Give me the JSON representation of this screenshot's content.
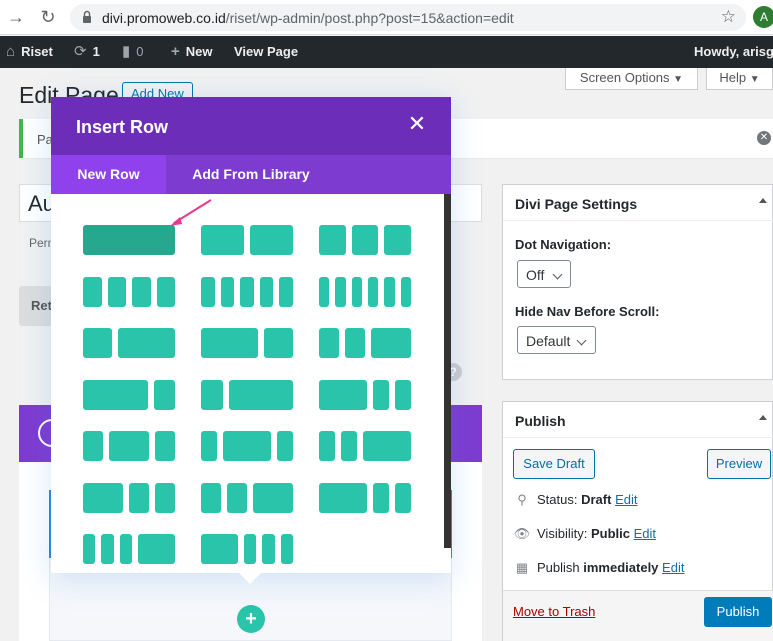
{
  "browser": {
    "url_host": "divi.promoweb.co.id",
    "url_path": "/riset/wp-admin/post.php?post=15&action=edit",
    "profile_initial": "A"
  },
  "admin_bar": {
    "site_name": "Riset",
    "updates_count": "1",
    "comments_count": "0",
    "new_label": "New",
    "view_page_label": "View Page",
    "greeting": "Howdy, arisg"
  },
  "header": {
    "title": "Edit Page",
    "add_new": "Add New",
    "screen_options": "Screen Options",
    "help": "Help"
  },
  "notice": {
    "text": "Pa"
  },
  "editor": {
    "title_value": "Au",
    "permalink_label": "Perm",
    "return_label": "Ret"
  },
  "modal": {
    "title": "Insert Row",
    "tabs": [
      {
        "label": "New Row",
        "active": true
      },
      {
        "label": "Add From Library",
        "active": false
      }
    ],
    "layouts": [
      [
        1
      ],
      [
        1,
        1
      ],
      [
        1,
        1,
        1
      ],
      [
        1,
        1,
        1,
        1
      ],
      [
        1,
        1,
        1,
        1,
        1
      ],
      [
        1,
        1,
        1,
        1,
        1,
        1
      ],
      [
        1,
        2
      ],
      [
        2,
        1
      ],
      [
        1,
        1,
        2
      ],
      [
        3,
        1
      ],
      [
        1,
        3
      ],
      [
        3,
        1,
        1
      ],
      [
        1,
        2,
        1
      ],
      [
        1,
        3,
        1
      ],
      [
        1,
        1,
        3
      ],
      [
        2,
        1,
        1
      ],
      [
        1,
        1,
        2
      ],
      [
        3,
        1,
        1
      ],
      [
        1,
        1,
        1,
        3
      ],
      [
        3,
        1,
        1,
        1
      ]
    ],
    "selected_layout_index": 0
  },
  "divi_settings": {
    "title": "Divi Page Settings",
    "dot_nav_label": "Dot Navigation:",
    "dot_nav_value": "Off",
    "hide_nav_label": "Hide Nav Before Scroll:",
    "hide_nav_value": "Default"
  },
  "publish": {
    "title": "Publish",
    "save_draft": "Save Draft",
    "preview": "Preview",
    "status_label": "Status:",
    "status_value": "Draft",
    "visibility_label": "Visibility:",
    "visibility_value": "Public",
    "publish_label": "Publish",
    "publish_value": "immediately",
    "edit": "Edit",
    "move_to_trash": "Move to Trash",
    "publish_button": "Publish"
  },
  "colors": {
    "divi_purple_dark": "#6c2eb9",
    "divi_purple": "#7e3bd0",
    "divi_purple_active": "#8f42ec",
    "layout_teal": "#29c4a9",
    "layout_teal_selected": "#26a88f",
    "arrow_pink": "#e8398e",
    "wp_blue": "#007cba",
    "wp_dark": "#23282d"
  }
}
